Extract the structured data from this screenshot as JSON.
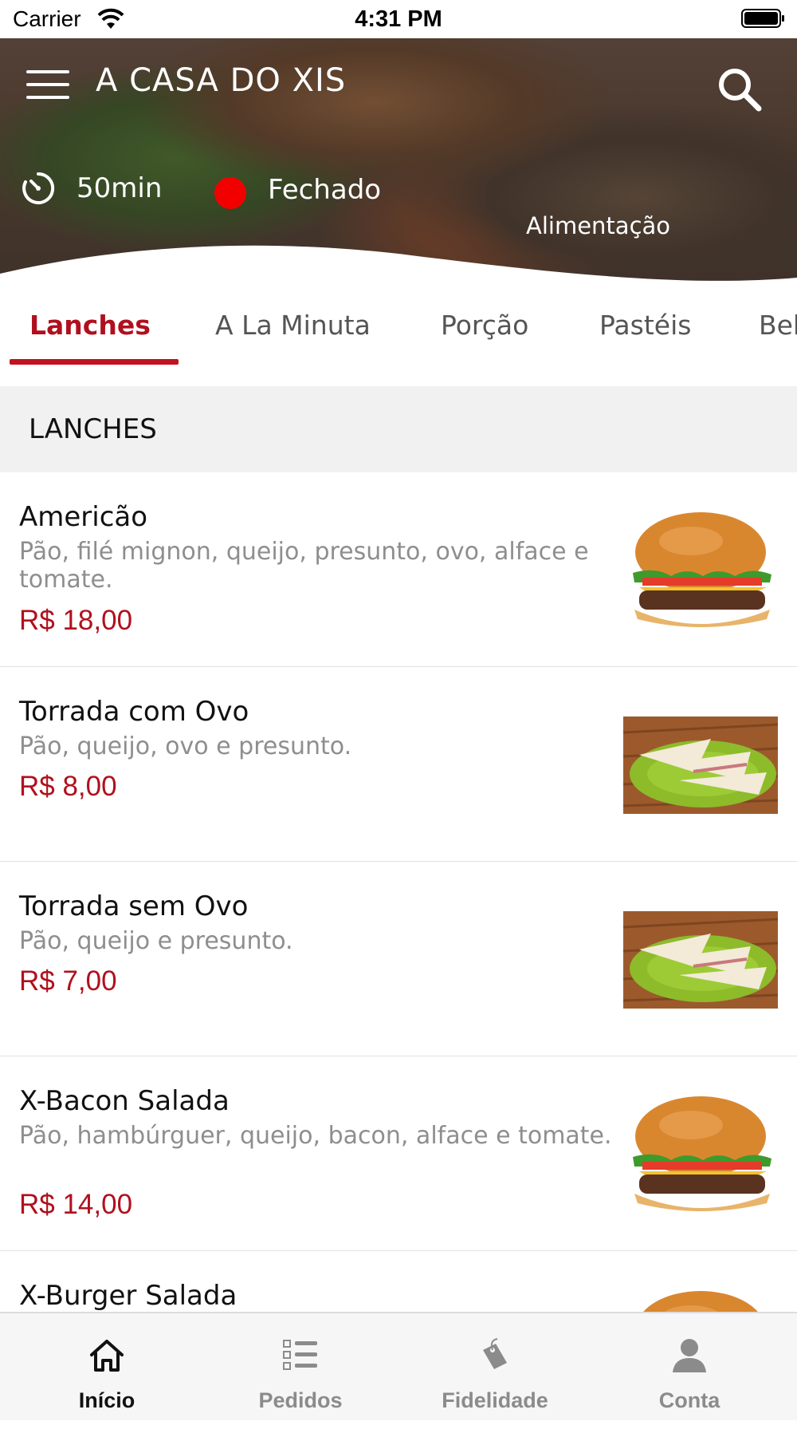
{
  "status_bar": {
    "carrier": "Carrier",
    "time": "4:31 PM"
  },
  "header": {
    "title": "A CASA DO XIS",
    "delivery_time": "50min",
    "status": "Fechado",
    "status_color": "#f20000",
    "category": "Alimentação"
  },
  "tabs": [
    {
      "label": "Lanches",
      "active": true
    },
    {
      "label": "A La Minuta"
    },
    {
      "label": "Porção"
    },
    {
      "label": "Pastéis"
    },
    {
      "label": "Beb"
    }
  ],
  "section_title": "LANCHES",
  "items": [
    {
      "name": "Americão",
      "description": "Pão, filé mignon, queijo, presunto, ovo, alface e tomate.",
      "price": "R$ 18,00",
      "image": "burger"
    },
    {
      "name": "Torrada com Ovo",
      "description": "Pão, queijo, ovo e presunto.",
      "price": "R$ 8,00",
      "image": "sandwich"
    },
    {
      "name": "Torrada sem Ovo",
      "description": "Pão, queijo e presunto.",
      "price": "R$ 7,00",
      "image": "sandwich"
    },
    {
      "name": "X-Bacon Salada",
      "description": "Pão, hambúrguer, queijo, bacon, alface e tomate.",
      "price": "R$ 14,00",
      "image": "burger"
    },
    {
      "name": "X-Burger Salada",
      "image": "burger"
    }
  ],
  "bottom_nav": [
    {
      "label": "Início",
      "icon": "home-icon",
      "active": true
    },
    {
      "label": "Pedidos",
      "icon": "orders-list-icon"
    },
    {
      "label": "Fidelidade",
      "icon": "loyalty-tag-icon"
    },
    {
      "label": "Conta",
      "icon": "account-person-icon"
    }
  ],
  "colors": {
    "accent": "#b0101e",
    "status_closed": "#f20000",
    "muted_text": "#8e8e8e"
  }
}
